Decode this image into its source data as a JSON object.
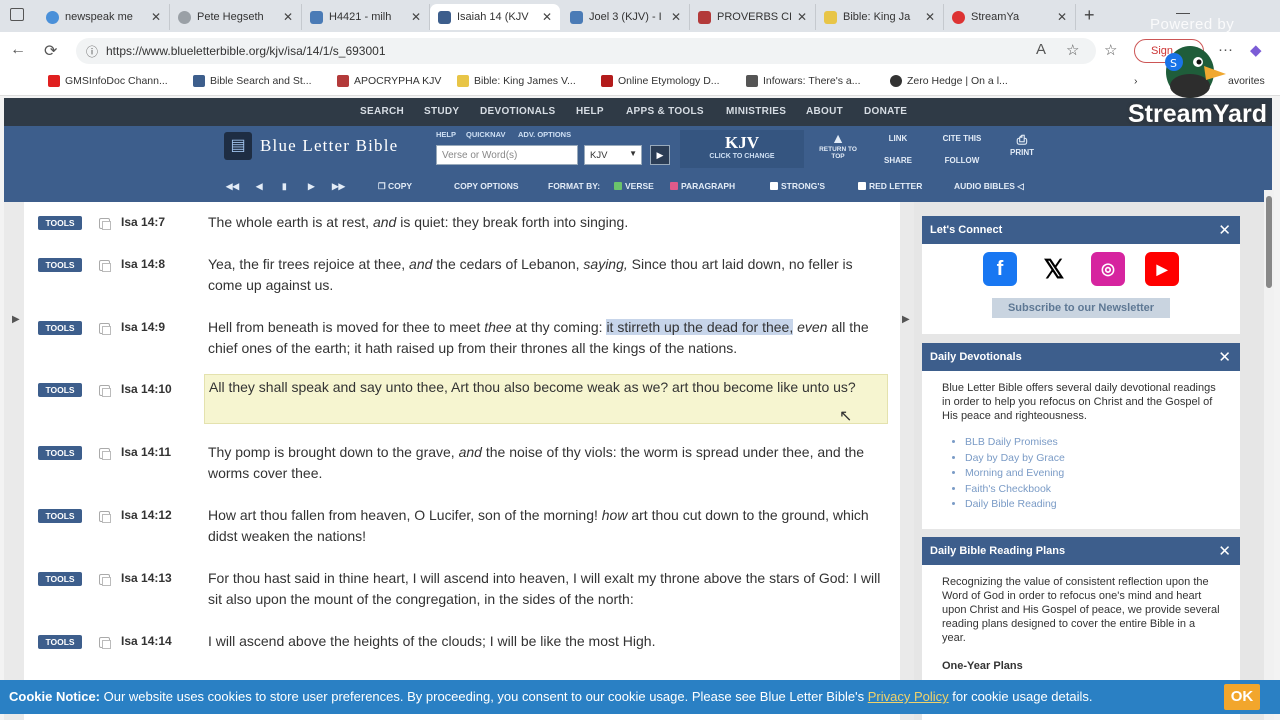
{
  "browser": {
    "tabs": [
      {
        "label": "newspeak me",
        "color": "#4a90d9"
      },
      {
        "label": "Pete Hegseth",
        "color": "#9aa0a6"
      },
      {
        "label": "H4421 - milh",
        "color": "#4a7bb6"
      },
      {
        "label": "Isaiah 14 (KJV",
        "color": "#3d5e8c"
      },
      {
        "label": "Joel 3 (KJV) - I",
        "color": "#4a7bb6"
      },
      {
        "label": "PROVERBS CH",
        "color": "#b33a3a"
      },
      {
        "label": "Bible: King Ja",
        "color": "#e8c547"
      },
      {
        "label": "StreamYa",
        "color": "#d33"
      }
    ],
    "url": "https://www.blueletterbible.org/kjv/isa/14/1/s_693001",
    "signin_label": "Sign",
    "bookmarks": [
      {
        "label": "GMSInfoDoc Chann...",
        "color": "#e02020"
      },
      {
        "label": "Bible Search and St...",
        "color": "#3d5e8c"
      },
      {
        "label": "APOCRYPHA KJV",
        "color": "#b33a3a"
      },
      {
        "label": "Bible: King James V...",
        "color": "#e8c547"
      },
      {
        "label": "Online Etymology D...",
        "color": "#b31b1b"
      },
      {
        "label": "Infowars: There's a...",
        "color": "#555"
      },
      {
        "label": "Zero Hedge | On a l...",
        "color": "#333"
      }
    ],
    "bookmarks_overflow": "avorites"
  },
  "overlay": {
    "powered": "Powered by",
    "streamyard": "StreamYard"
  },
  "site": {
    "topnav": [
      "SEARCH",
      "STUDY",
      "DEVOTIONALS",
      "HELP",
      "APPS & TOOLS",
      "MINISTRIES",
      "ABOUT",
      "DONATE"
    ],
    "logo_text": "Blue Letter Bible",
    "mini_links": [
      "HELP",
      "QUICKNAV",
      "ADV. OPTIONS"
    ],
    "search_placeholder": "Verse or Word(s)",
    "version": "KJV",
    "kjv_label": "KJV",
    "kjv_sub": "CLICK TO CHANGE",
    "return_label": "RETURN TO TOP",
    "link_label": "LINK",
    "share_label": "SHARE",
    "cite_label": "CITE THIS",
    "follow_label": "FOLLOW",
    "print_label": "PRINT",
    "toolbar": {
      "copy": "COPY",
      "copy_options": "COPY OPTIONS",
      "format_by": "FORMAT BY:",
      "verse": "VERSE",
      "paragraph": "PARAGRAPH",
      "strongs": "STRONG'S",
      "red_letter": "RED LETTER",
      "audio": "AUDIO BIBLES"
    }
  },
  "verses": [
    {
      "ref": "Isa 14:7",
      "pre": "The whole earth is at rest, ",
      "it1": "and",
      "mid": " is quiet: they break forth into singing.",
      "sel": "",
      "it2": "",
      "post": ""
    },
    {
      "ref": "Isa 14:8",
      "pre": "Yea, the fir trees rejoice at thee, ",
      "it1": "and",
      "mid": " the cedars of Lebanon, ",
      "sel": "",
      "it2": "saying,",
      "post": " Since thou art laid down, no feller is come up against us."
    },
    {
      "ref": "Isa 14:9",
      "pre": "Hell from beneath is moved for thee to meet ",
      "it1": "thee",
      "mid": " at thy coming: ",
      "sel": "it stirreth up the dead for thee,",
      "it2": " even",
      "post": " all the chief ones of the earth; it hath raised up from their thrones all the kings of the nations."
    },
    {
      "ref": "Isa 14:10",
      "pre": "All they shall speak and say unto thee, Art thou also become weak as we? art thou become like unto us?",
      "it1": "",
      "mid": "",
      "sel": "",
      "it2": "",
      "post": ""
    },
    {
      "ref": "Isa 14:11",
      "pre": "Thy pomp is brought down to the grave, ",
      "it1": "and",
      "mid": " the noise of thy viols: the worm is spread under thee, and the worms cover thee.",
      "sel": "",
      "it2": "",
      "post": ""
    },
    {
      "ref": "Isa 14:12",
      "pre": "How art thou fallen from heaven, O Lucifer, son of the morning! ",
      "it1": "how",
      "mid": " art thou cut down to the ground, which didst weaken the nations!",
      "sel": "",
      "it2": "",
      "post": ""
    },
    {
      "ref": "Isa 14:13",
      "pre": "For thou hast said in thine heart, I will ascend into heaven, I will exalt my throne above the stars of God: I will sit also upon the mount of the congregation, in the sides of the north:",
      "it1": "",
      "mid": "",
      "sel": "",
      "it2": "",
      "post": ""
    },
    {
      "ref": "Isa 14:14",
      "pre": "I will ascend above the heights of the clouds; I will be like the most High.",
      "it1": "",
      "mid": "",
      "sel": "",
      "it2": "",
      "post": ""
    }
  ],
  "tools_label": "TOOLS",
  "sidebar": {
    "connect": {
      "title": "Let's Connect",
      "newsletter": "Subscribe to our Newsletter"
    },
    "devotionals": {
      "title": "Daily Devotionals",
      "desc": "Blue Letter Bible offers several daily devotional readings in order to help you refocus on Christ and the Gospel of His peace and righteousness.",
      "items": [
        "BLB Daily Promises",
        "Day by Day by Grace",
        "Morning and Evening",
        "Faith's Checkbook",
        "Daily Bible Reading"
      ]
    },
    "plans": {
      "title": "Daily Bible Reading Plans",
      "desc": "Recognizing the value of consistent reflection upon the Word of God in order to refocus one's mind and heart upon Christ and His Gospel of peace, we provide several reading plans designed to cover the entire Bible in a year.",
      "sub": "One-Year Plans"
    }
  },
  "cookie": {
    "label": "Cookie Notice:",
    "text": " Our website uses cookies to store user preferences. By proceeding, you consent to our cookie usage. Please see Blue Letter Bible's ",
    "link": "Privacy Policy",
    "tail": " for cookie usage details.",
    "ok": "OK"
  }
}
